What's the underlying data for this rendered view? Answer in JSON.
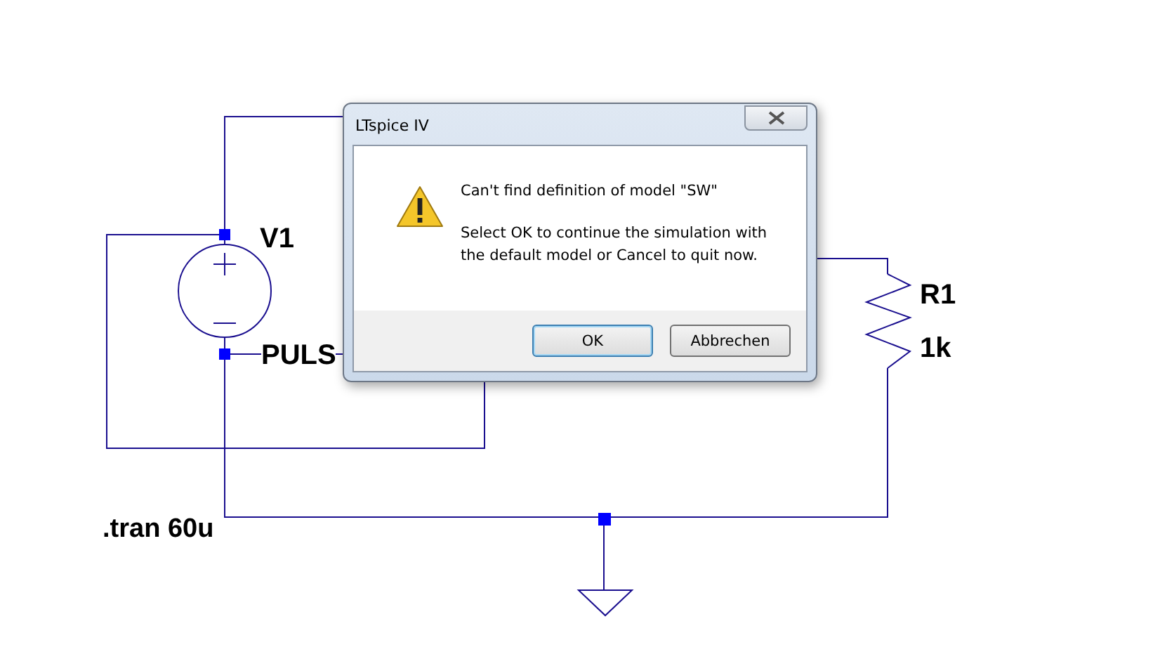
{
  "schematic": {
    "labels": [
      {
        "kind": "name",
        "text": "V1"
      },
      {
        "kind": "value",
        "text": "PULS"
      },
      {
        "kind": "name",
        "text": "R1"
      },
      {
        "kind": "value",
        "text": "1k"
      },
      {
        "kind": "directive",
        "text": ".tran 60u"
      }
    ]
  },
  "dialog": {
    "title": "LTspice IV",
    "message": "Can't find definition of model \"SW\"",
    "detail": [
      "Select OK to continue the simulation with",
      "the default model or Cancel to quit now."
    ],
    "buttons": [
      {
        "label": "OK",
        "default": true
      },
      {
        "label": "Abbrechen",
        "default": false
      }
    ]
  }
}
